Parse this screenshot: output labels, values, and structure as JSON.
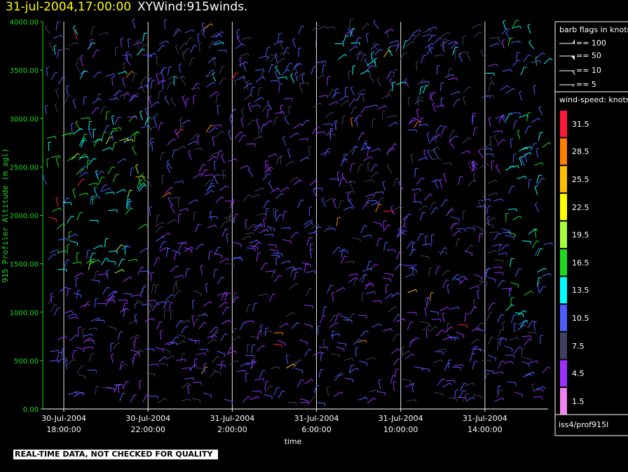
{
  "header": {
    "timestamp": "31-jul-2004,17:00:00",
    "product": "XYWind:915winds."
  },
  "disclaimer": "REAL-TIME DATA, NOT CHECKED FOR QUALITY",
  "source": "iss4/prof915l",
  "legend": {
    "flags_title": "barb flags in knots",
    "flags": [
      "== 100",
      "== 50",
      "== 10",
      "== 5"
    ],
    "speed_title": "wind-speed: knots",
    "speed_bins": [
      {
        "label": "31.5",
        "color": "#ff1a3c"
      },
      {
        "label": "28.5",
        "color": "#ff8000"
      },
      {
        "label": "25.5",
        "color": "#ffbf00"
      },
      {
        "label": "22.5",
        "color": "#ffff00"
      },
      {
        "label": "19.5",
        "color": "#a8ff3e"
      },
      {
        "label": "16.5",
        "color": "#1ed91e"
      },
      {
        "label": "13.5",
        "color": "#00ffff"
      },
      {
        "label": "10.5",
        "color": "#4d5dff"
      },
      {
        "label": "7.5",
        "color": "#404060"
      },
      {
        "label": "4.5",
        "color": "#9b30ff"
      },
      {
        "label": "1.5",
        "color": "#ee82ee"
      }
    ]
  },
  "chart_data": {
    "type": "scatter",
    "ylabel": "915 Profiler Altitude (m agl)",
    "xlabel": "time",
    "ylim": [
      0,
      4000
    ],
    "yticks": [
      "0.00",
      "500.00",
      "1000.00",
      "1500.00",
      "2000.00",
      "2500.00",
      "3000.00",
      "3500.00",
      "4000.00"
    ],
    "xticks": [
      {
        "date": "30-Jul-2004",
        "time": "18:00:00"
      },
      {
        "date": "30-Jul-2004",
        "time": "22:00:00"
      },
      {
        "date": "31-Jul-2004",
        "time": "2:00:00"
      },
      {
        "date": "31-Jul-2004",
        "time": "6:00:00"
      },
      {
        "date": "31-Jul-2004",
        "time": "10:00:00"
      },
      {
        "date": "31-Jul-2004",
        "time": "14:00:00"
      }
    ],
    "xlim_hours": [
      17.0,
      41.0
    ],
    "grid": "vertical at each x tick",
    "series_note": "wind barbs colored by wind speed bin"
  },
  "colors": {
    "axis": "#1ed91e",
    "grid": "#ffffff",
    "title_time": "#ffff00",
    "title_product": "#ffffff"
  }
}
